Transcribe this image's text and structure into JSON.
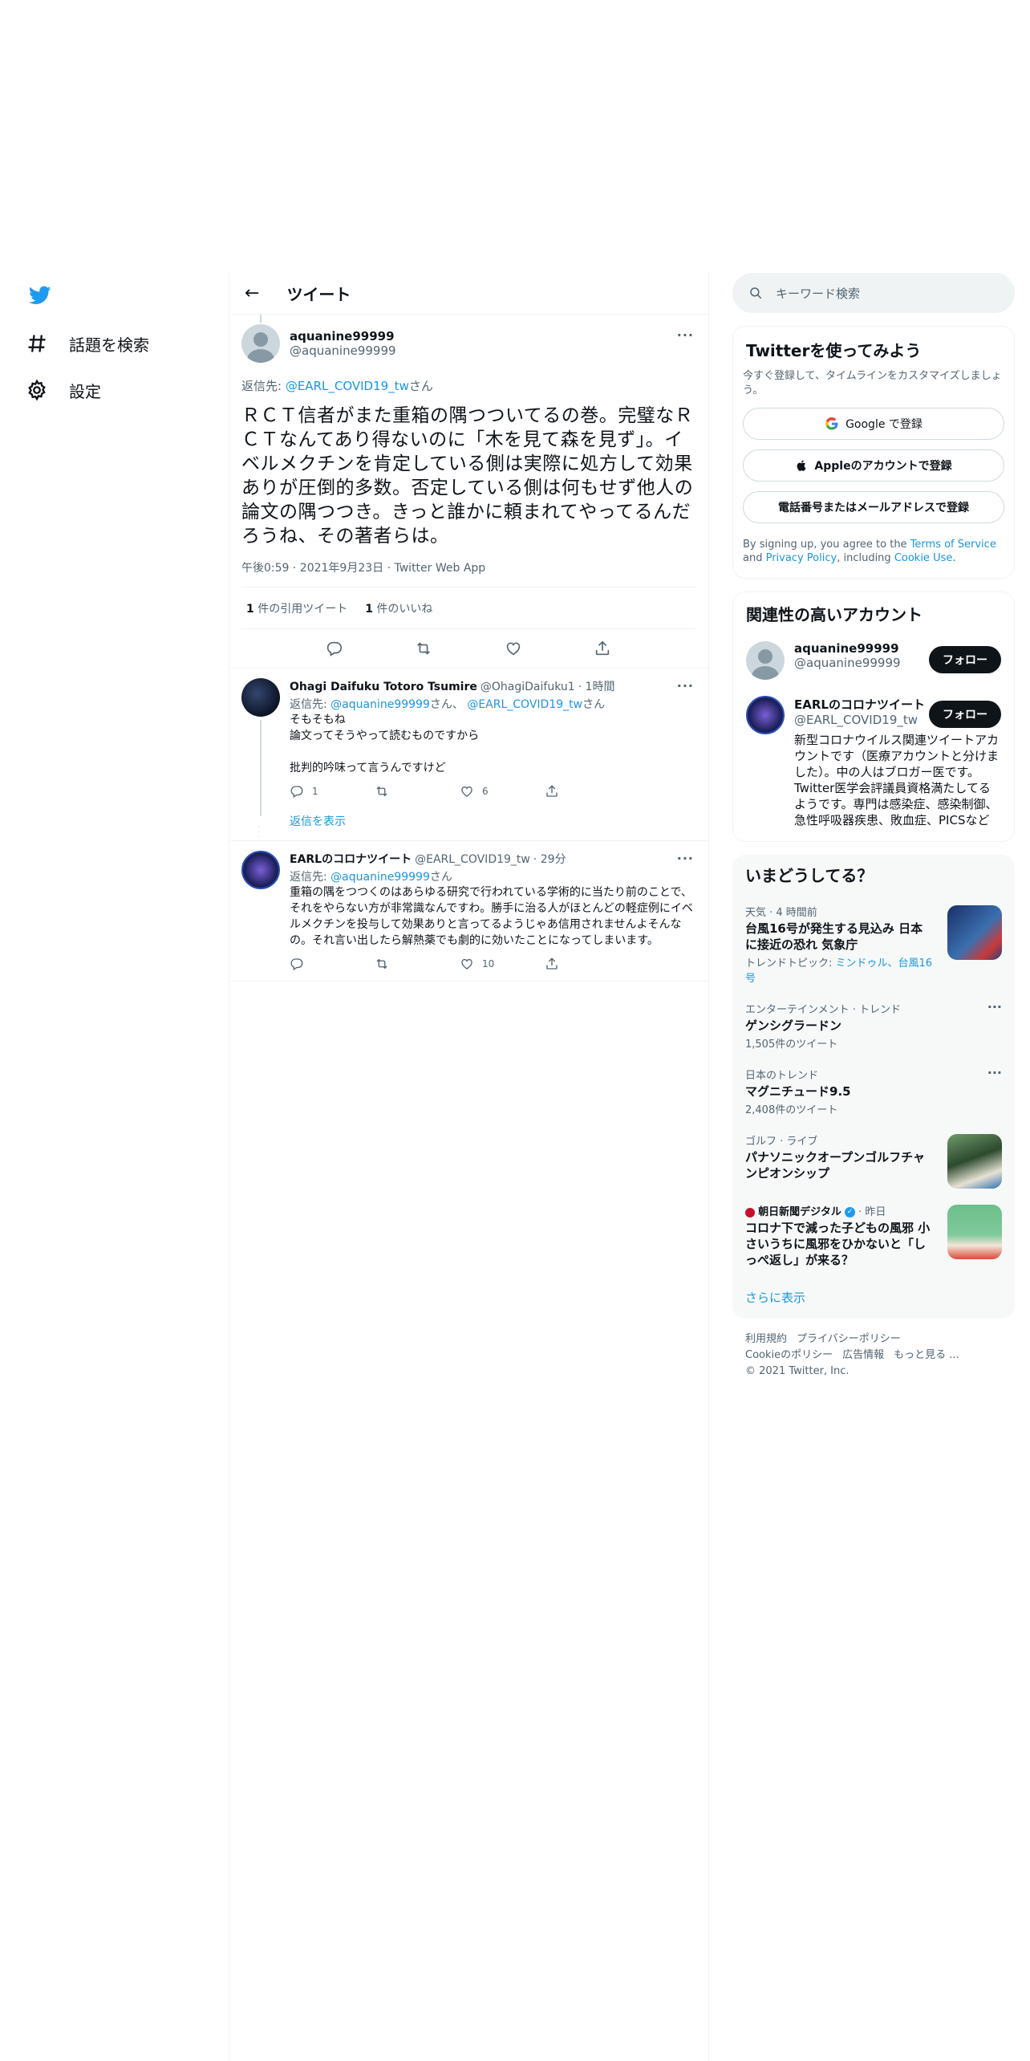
{
  "nav": {
    "explore": "話題を検索",
    "settings": "設定"
  },
  "header": {
    "back": "←",
    "title": "ツイート"
  },
  "focal_tweet": {
    "name": "aquanine99999",
    "handle": "@aquanine99999",
    "reply_prefix": "返信先: ",
    "reply_to": "@EARL_COVID19_tw",
    "reply_suffix": "さん",
    "text": "ＲＣＴ信者がまた重箱の隅つついてるの巻。完璧なＲＣＴなんてあり得ないのに「木を見て森を見ず」。イベルメクチンを肯定している側は実際に処方して効果ありが圧倒的多数。否定している側は何もせず他人の論文の隅つつき。きっと誰かに頼まれてやってるんだろうね、その著者らは。",
    "meta": "午後0:59 · 2021年9月23日 · Twitter Web App",
    "quote_count": "1",
    "quote_label": " 件の引用ツイート",
    "like_count": "1",
    "like_label": " 件のいいね"
  },
  "replies": [
    {
      "name": "Ohagi Daifuku Totoro Tsumire",
      "handle": "@OhagiDaifuku1",
      "time": "· 1時間",
      "reply_prefix": "返信先: ",
      "reply_to_1": "@aquanine99999",
      "reply_mid": "さん、",
      "reply_to_2": "@EARL_COVID19_tw",
      "reply_suffix": "さん",
      "text": "そもそもね\n論文ってそうやって読むものですから\n\n批判的吟味って言うんですけど",
      "reply_count": "1",
      "retweet_count": "",
      "like_count": "6",
      "show_replies": "返信を表示"
    },
    {
      "name": "EARLのコロナツイート",
      "handle": "@EARL_COVID19_tw",
      "time": "· 29分",
      "reply_prefix": "返信先: ",
      "reply_to_1": "@aquanine99999",
      "reply_suffix": "さん",
      "text": "重箱の隅をつつくのはあらゆる研究で行われている学術的に当たり前のことで、それをやらない方が非常識なんですわ。勝手に治る人がほとんどの軽症例にイベルメクチンを投与して効果ありと言ってるようじゃあ信用されませんよそんなの。それ言い出したら解熱薬でも劇的に効いたことになってしまいます。",
      "reply_count": "",
      "retweet_count": "",
      "like_count": "10"
    }
  ],
  "search": {
    "placeholder": "キーワード検索"
  },
  "signup": {
    "title": "Twitterを使ってみよう",
    "subtitle": "今すぐ登録して、タイムラインをカスタマイズしましょう。",
    "google": "Google で登録",
    "apple": "Appleのアカウントで登録",
    "phone": "電話番号またはメールアドレスで登録",
    "terms_1": "By signing up, you agree to the ",
    "terms_link_1": "Terms of Service",
    "terms_2": " and ",
    "terms_link_2": "Privacy Policy",
    "terms_3": ", including ",
    "terms_link_3": "Cookie Use",
    "terms_4": "."
  },
  "relevant": {
    "title": "関連性の高いアカウント",
    "accounts": [
      {
        "name": "aquanine99999",
        "handle": "@aquanine99999",
        "follow": "フォロー",
        "bio": ""
      },
      {
        "name": "EARLのコロナツイート",
        "handle": "@EARL_COVID19_tw",
        "follow": "フォロー",
        "bio": "新型コロナウイルス関連ツイートアカウントです（医療アカウントと分けました）。中の人はブロガー医です。Twitter医学会評議員資格満たしてるようです。専門は感染症、感染制御、急性呼吸器疾患、敗血症、PICSなど"
      }
    ]
  },
  "trends": {
    "title": "いまどうしてる？",
    "items": [
      {
        "context": "天気 · 4 時間前",
        "name": "台風16号が発生する見込み 日本に接近の恐れ 気象庁",
        "link_prefix": "トレンドトピック: ",
        "link": "ミンドゥル、台風16号"
      },
      {
        "context": "エンターテインメント · トレンド",
        "name": "ゲンシグラードン",
        "count": "1,505件のツイート"
      },
      {
        "context": "日本のトレンド",
        "name": "マグニチュード9.5",
        "count": "2,408件のツイート"
      },
      {
        "context": "ゴルフ · ライブ",
        "name": "パナソニックオープンゴルフチャンピオンシップ"
      },
      {
        "source": "朝日新聞デジタル",
        "time": " · 昨日",
        "name": "コロナ下で減った子どもの風邪 小さいうちに風邪をひかないと「しっぺ返し」が来る？"
      }
    ],
    "show_more": "さらに表示"
  },
  "footer": {
    "terms": "利用規約",
    "privacy": "プライバシーポリシー",
    "cookie": "Cookieのポリシー",
    "ads": "広告情報",
    "more": "もっと見る ...",
    "copyright": "© 2021 Twitter, Inc."
  },
  "colors": {
    "accent": "#1b95e0",
    "twitter_blue": "#1d9bf0",
    "follow_bg": "#0f1419"
  }
}
